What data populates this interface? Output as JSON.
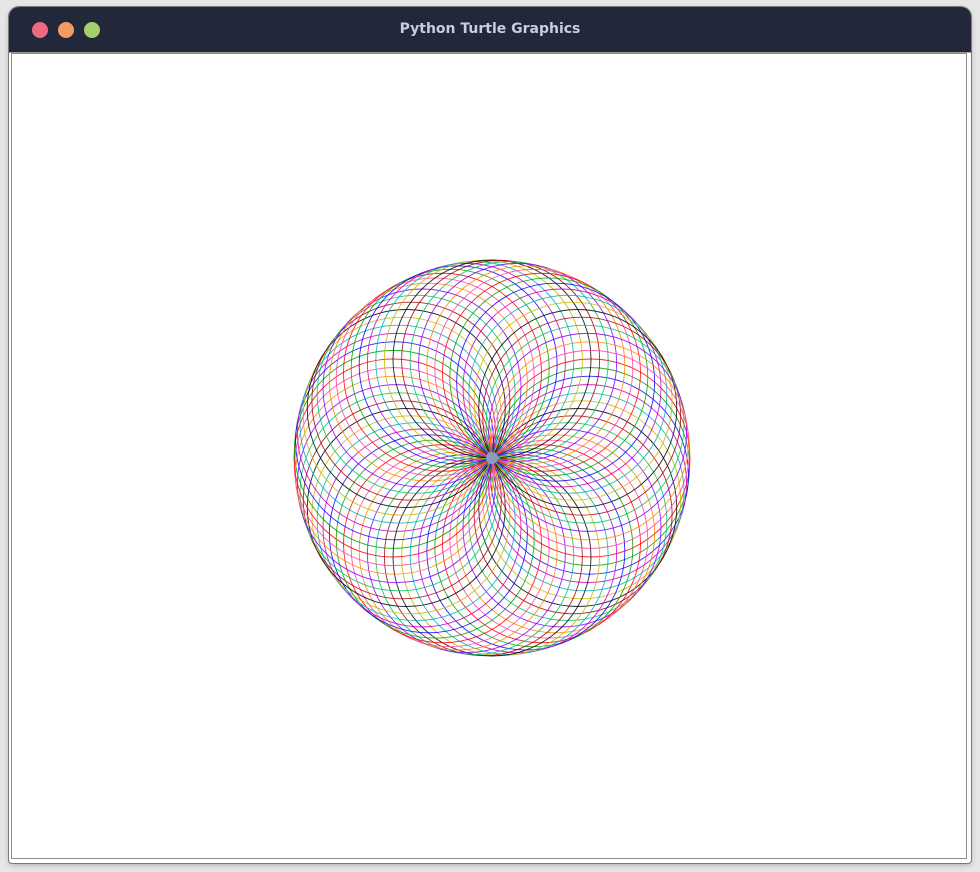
{
  "window": {
    "title": "Python Turtle Graphics",
    "buttons": {
      "close_color": "#ee6a80",
      "minimize_color": "#f49a63",
      "maximize_color": "#a4cf6a"
    }
  },
  "canvas": {
    "background": "#ffffff",
    "drawing": {
      "shape": "spirograph of overlapping circles",
      "circle_count": 72,
      "palette": [
        "#ff0000",
        "#00a000",
        "#0000ff",
        "#c000c0",
        "#00b0b0",
        "#c8b400",
        "#000000",
        "#a00000",
        "#00c060",
        "#8000ff",
        "#ff8000",
        "#ff40a0"
      ],
      "turtle_color": "#8c9cbd"
    }
  }
}
